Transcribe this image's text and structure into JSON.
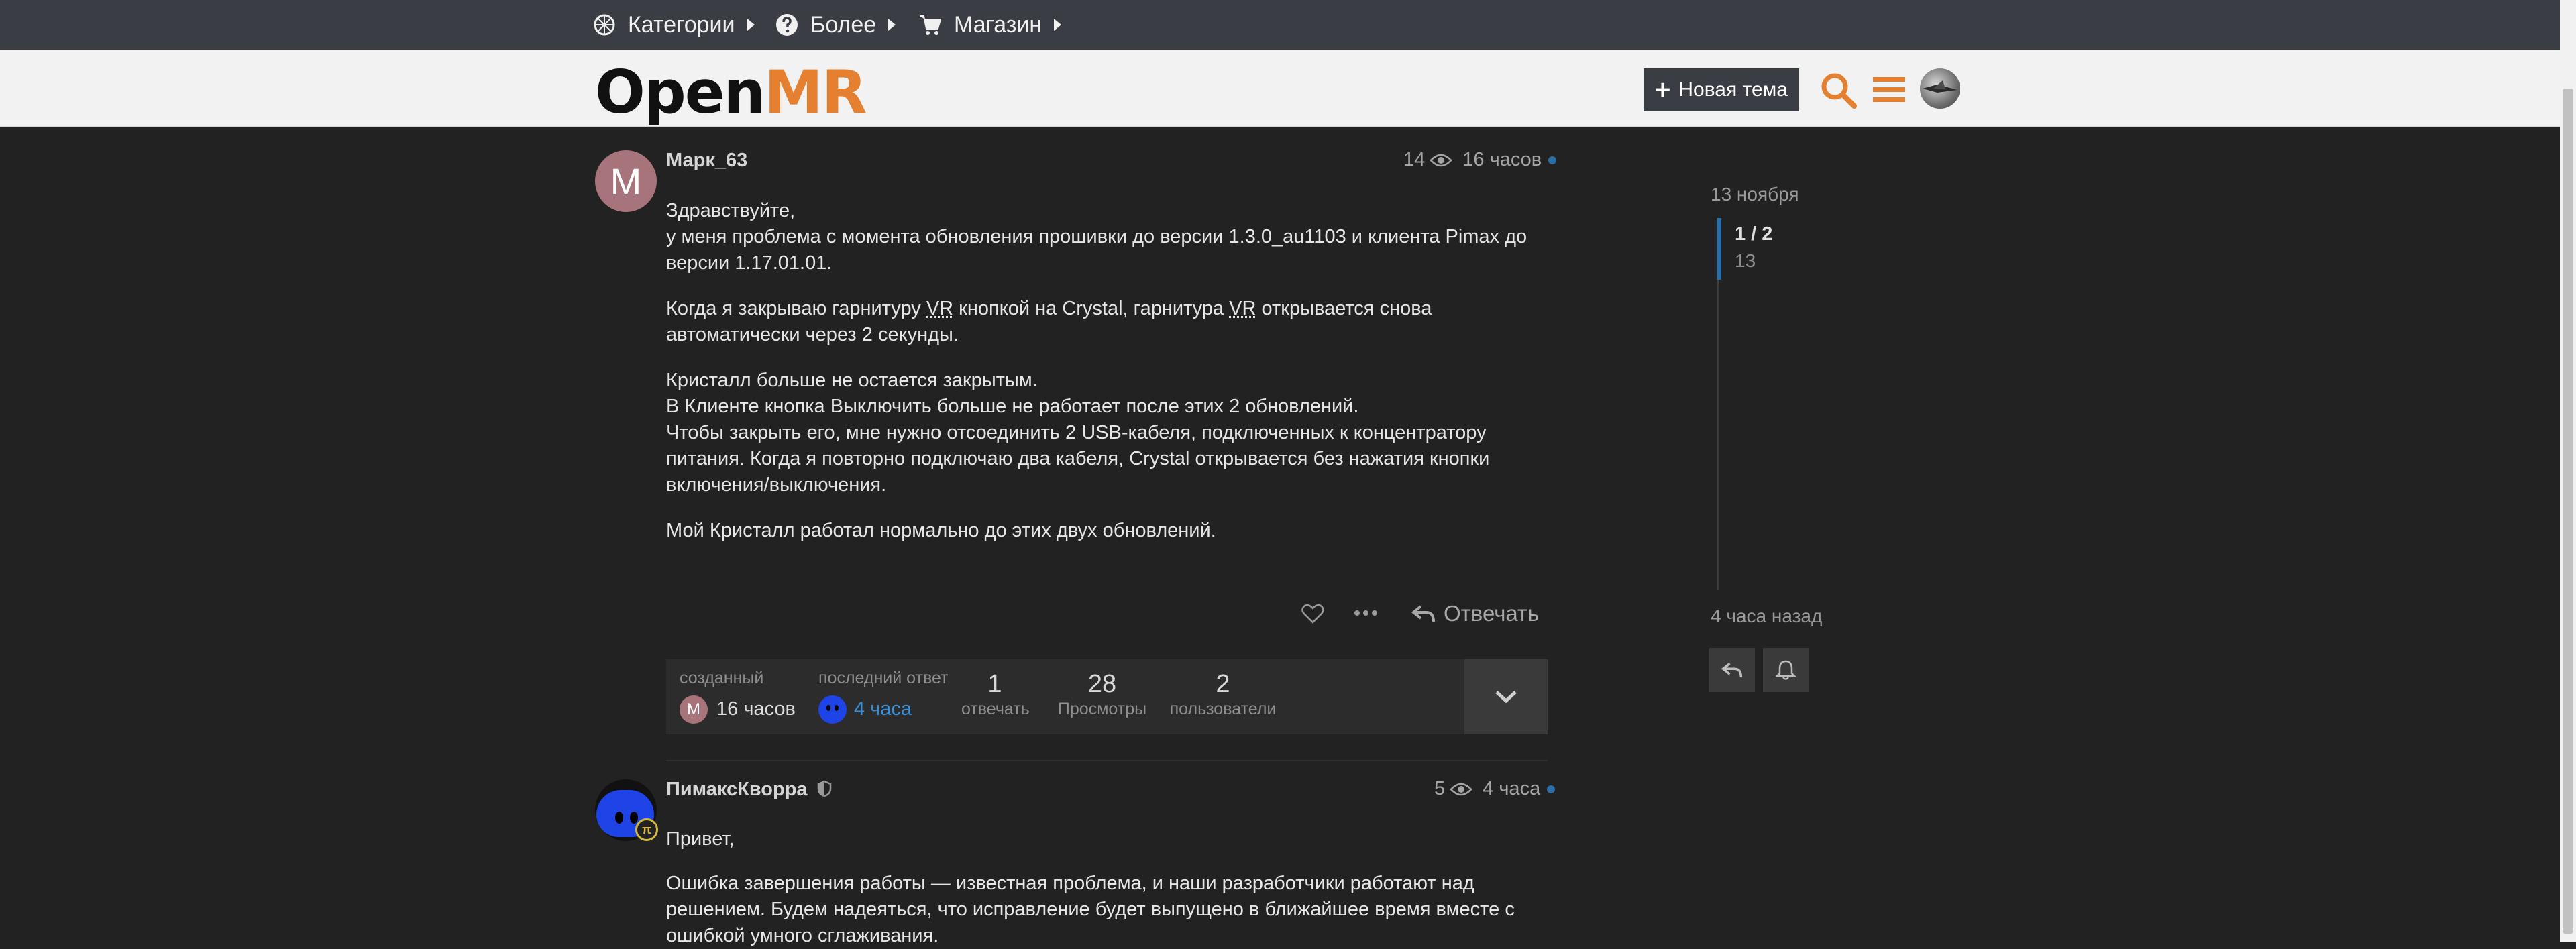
{
  "nav": {
    "items": [
      {
        "label": "Категории",
        "icon": "categories-icon"
      },
      {
        "label": "Более",
        "icon": "question-circle-icon"
      },
      {
        "label": "Магазин",
        "icon": "cart-icon"
      }
    ]
  },
  "header": {
    "logo_part1": "Open",
    "logo_part2": "MR",
    "new_topic_label": "Новая тема"
  },
  "post1": {
    "avatar_letter": "M",
    "username": "Марк_63",
    "views": "14",
    "time": "16 часов",
    "p1_l1": "Здравствуйте,",
    "p1_l2": "у меня проблема с момента обновления прошивки до версии 1.3.0_au1103 и клиента Pimax до",
    "p1_l3": "версии 1.17.01.01.",
    "p2_a": "Когда я закрываю гарнитуру ",
    "p2_vr1": "VR",
    "p2_b": " кнопкой на Crystal, гарнитура ",
    "p2_vr2": "VR",
    "p2_c": " открывается снова",
    "p2_l2": "автоматически через 2 секунды.",
    "p3_l1": "Кристалл больше не остается закрытым.",
    "p3_l2": "В Клиенте кнопка Выключить больше не работает после этих 2 обновлений.",
    "p3_l3": "Чтобы закрыть его, мне нужно отсоединить 2 USB-кабеля, подключенных к концентратору",
    "p3_l4": "питания. Когда я повторно подключаю два кабеля, Crystal открывается без нажатия кнопки",
    "p3_l5": "включения/выключения.",
    "p4": "Мой Кристалл работал нормально до этих двух обновлений.",
    "reply_label": "Отвечать"
  },
  "topic_map": {
    "created_label": "созданный",
    "created_avatar_letter": "M",
    "created_value": "16 часов",
    "last_reply_label": "последний ответ",
    "last_reply_value": "4 часа",
    "replies_count": "1",
    "replies_label": "отвечать",
    "views_count": "28",
    "views_label": "Просмотры",
    "users_count": "2",
    "users_label": "пользователи"
  },
  "post2": {
    "username": "ПимаксКворра",
    "badge": "π",
    "views": "5",
    "time": "4 часа",
    "p1": "Привет,",
    "p2_l1": "Ошибка завершения работы — известная проблема, и наши разработчики работают над",
    "p2_l2": "решением. Будем надеяться, что исправление будет выпущено в ближайшее время вместе с",
    "p2_l3": "ошибкой умного сглаживания."
  },
  "timeline": {
    "start_date": "13 ноября",
    "position": "1 / 2",
    "position_date": "13",
    "end_label": "4 часа назад"
  },
  "colors": {
    "accent": "#e4802f",
    "background": "#222222",
    "header_bg": "#f2f2f2",
    "top_bar": "#3a3e44",
    "timeline_handle": "#2b6ea8",
    "link": "#3a8fd6"
  }
}
